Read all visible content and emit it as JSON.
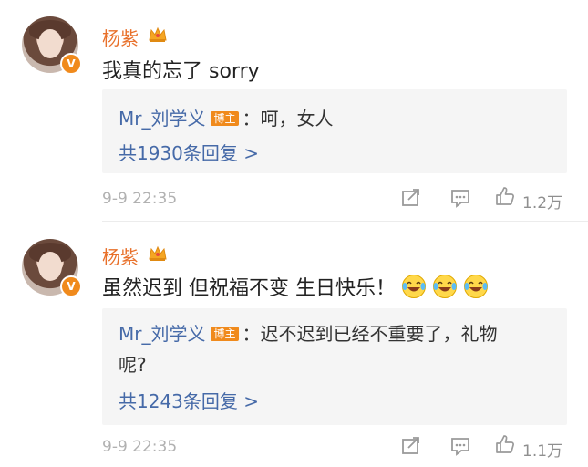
{
  "comments": [
    {
      "author": "杨紫",
      "text": "我真的忘了 sorry",
      "reply": {
        "user": "Mr_刘学义",
        "tag": "博主",
        "text": "：呵，女人",
        "text_line2": "",
        "more": "共1930条回复 >"
      },
      "time": "9-9 22:35",
      "likes": "1.2万"
    },
    {
      "author": "杨紫",
      "text": "虽然迟到 但祝福不变 生日快乐！",
      "emoji_count": 3,
      "reply": {
        "user": "Mr_刘学义",
        "tag": "博主",
        "text": "：迟不迟到已经不重要了，礼物",
        "text_line2": "呢?",
        "more": "共1243条回复 >"
      },
      "time": "9-9 22:35",
      "likes": "1.1万"
    }
  ],
  "icons": {
    "verified_badge": "V",
    "vip_crown": "crown-icon",
    "share": "share-icon",
    "comment": "comment-icon",
    "like": "thumb-up-icon"
  },
  "colors": {
    "author": "#e8702a",
    "link": "#466aa8",
    "badge": "#f08a1c",
    "meta": "#b1b1b1"
  }
}
